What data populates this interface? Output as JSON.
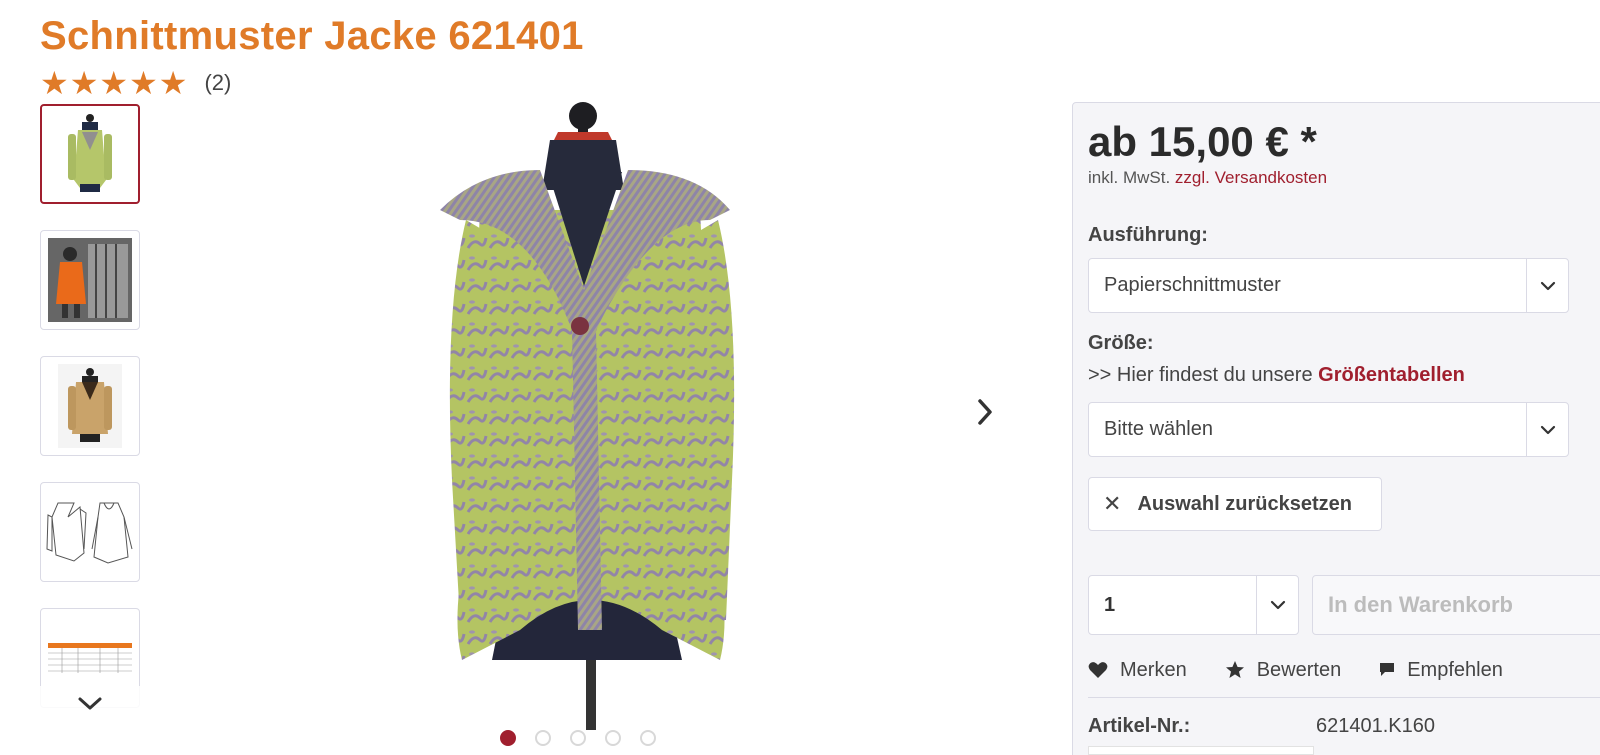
{
  "product": {
    "title": "Schnittmuster Jacke 621401",
    "rating": {
      "stars": 5,
      "max": 5,
      "count_label": "(2)"
    },
    "price": "ab 15,00 € *",
    "tax_note": "inkl. MwSt.",
    "shipping_link": "zzgl. Versandkosten",
    "article_label": "Artikel-Nr.:",
    "article_number": "621401.K160"
  },
  "gallery": {
    "thumbnails": [
      {
        "name": "thumb-green-jacket",
        "active": true
      },
      {
        "name": "thumb-orange-coat",
        "active": false
      },
      {
        "name": "thumb-beige-jacket",
        "active": false
      },
      {
        "name": "thumb-technical-drawing",
        "active": false
      },
      {
        "name": "thumb-size-table",
        "active": false
      }
    ],
    "dots": 5,
    "active_dot": 0
  },
  "options": {
    "variant_label": "Ausführung:",
    "variant_value": "Papierschnittmuster",
    "size_label": "Größe:",
    "size_hint_prefix": ">> Hier findest du unsere",
    "size_hint_link": "Größentabellen",
    "size_value": "Bitte wählen",
    "reset_label": "Auswahl zurücksetzen"
  },
  "purchase": {
    "quantity": "1",
    "cart_label": "In den Warenkorb"
  },
  "actions": {
    "remember": "Merken",
    "rate": "Bewerten",
    "recommend": "Empfehlen"
  },
  "colors": {
    "accent_orange": "#e07b28",
    "brand_red": "#a01f2e",
    "border": "#dadae5",
    "panel_bg": "#f5f5f8"
  },
  "icons": {
    "star": "star-icon",
    "chevron": "chevron-down-icon",
    "next": "chevron-right-icon",
    "heart": "heart-icon",
    "comment": "comment-icon",
    "close": "close-icon"
  }
}
